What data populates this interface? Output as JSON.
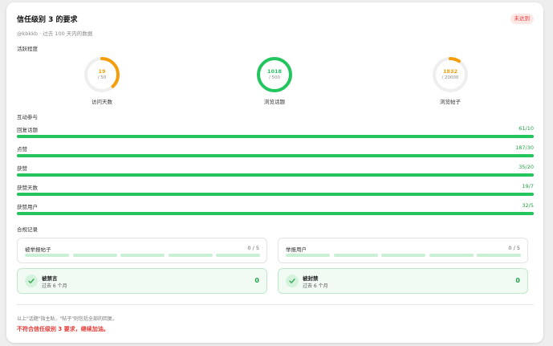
{
  "header": {
    "title": "信任级别 3 的要求",
    "badge": "未达到",
    "subtitle": "@kbkkb · 过去 100 天内的数据"
  },
  "activity": {
    "section_label": "活跃程度",
    "rings": [
      {
        "value": "19",
        "max": "/ 50",
        "label": "访问天数",
        "progress": 0.38,
        "color": "#f59e0b"
      },
      {
        "value": "1018",
        "max": "/ 500",
        "label": "浏览话题",
        "progress": 1.0,
        "color": "#22c55e"
      },
      {
        "value": "1832",
        "max": "/ 20000",
        "label": "浏览帖子",
        "progress": 0.0916,
        "color": "#f59e0b"
      }
    ]
  },
  "interaction": {
    "section_label": "互动参与",
    "bars": [
      {
        "label": "回复话题",
        "value": "61/10",
        "progress": 1.0
      },
      {
        "label": "点赞",
        "value": "187/30",
        "progress": 1.0
      },
      {
        "label": "获赞",
        "value": "35/20",
        "progress": 1.0
      },
      {
        "label": "获赞天数",
        "value": "19/7",
        "progress": 1.0
      },
      {
        "label": "获赞用户",
        "value": "32/5",
        "progress": 1.0
      }
    ]
  },
  "compliance": {
    "section_label": "合规记录",
    "reported_posts": {
      "label": "被举报帖子",
      "count": "0 / 5"
    },
    "reported_users": {
      "label": "举报用户",
      "count": "0 / 5"
    },
    "silenced": {
      "title": "被禁言",
      "sub": "过去 6 个月",
      "count": "0"
    },
    "suspended": {
      "title": "被封禁",
      "sub": "过去 6 个月",
      "count": "0"
    }
  },
  "footer": {
    "note": "以上\"话题\"指主贴，\"帖子\"则包括全部的回复。",
    "result": "不符合信任级别 3 要求，继续加油。"
  },
  "colors": {
    "green": "#22c55e",
    "orange": "#f59e0b",
    "red": "#e53935"
  }
}
